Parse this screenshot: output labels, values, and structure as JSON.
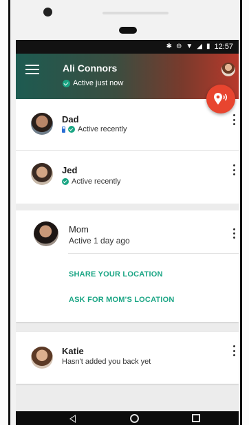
{
  "status_bar": {
    "time": "12:57",
    "icons": [
      "bluetooth-icon",
      "do-not-disturb-icon",
      "wifi-icon",
      "signal-icon",
      "battery-icon"
    ]
  },
  "header": {
    "menu_icon": "hamburger-menu-icon",
    "user_name": "Ali Connors",
    "user_status": "Active just now",
    "avatar_icon": "user-avatar"
  },
  "fab": {
    "icon": "share-location-icon"
  },
  "contacts": [
    {
      "name": "Dad",
      "status": "Active recently",
      "status_icons": [
        "battery-icon",
        "check-icon"
      ]
    },
    {
      "name": "Jed",
      "status": "Active recently",
      "status_icons": [
        "check-icon"
      ]
    },
    {
      "name": "Mom",
      "status": "Active 1 day ago",
      "actions": [
        "SHARE YOUR LOCATION",
        "ASK FOR MOM'S LOCATION"
      ]
    },
    {
      "name": "Katie",
      "status": "Hasn't added you back yet"
    }
  ],
  "colors": {
    "accent": "#1aa584",
    "fab": "#e8452f",
    "appbar_start": "#1d5b51",
    "appbar_end": "#b8392c"
  },
  "nav_bar": {
    "icons": [
      "back-icon",
      "home-icon",
      "recent-apps-icon"
    ]
  }
}
